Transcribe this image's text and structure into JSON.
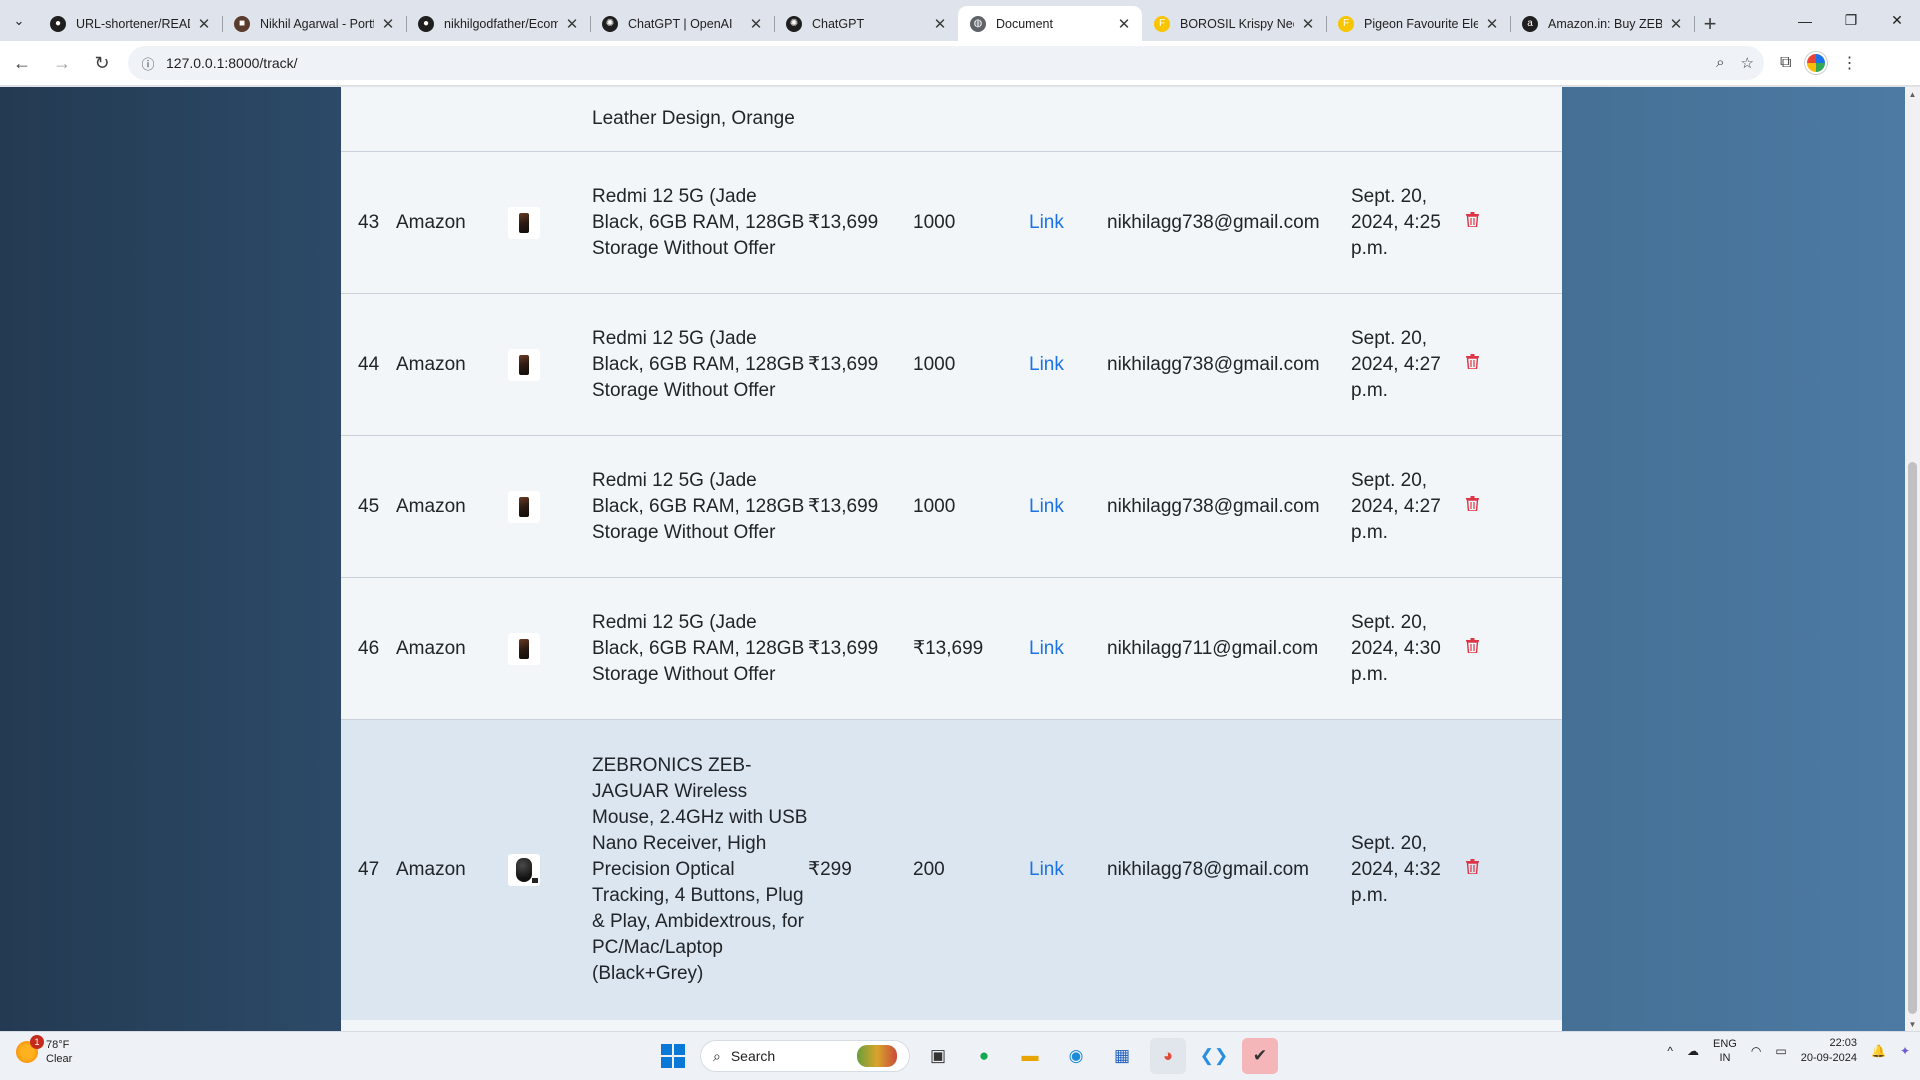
{
  "browser": {
    "tabs": [
      {
        "title": "URL-shortener/READM",
        "icon": "github-icon",
        "color": "#1f1f1f",
        "active": false
      },
      {
        "title": "Nikhil Agarwal - Portf",
        "icon": "portfolio-icon",
        "color": "#5a3b2e",
        "active": false
      },
      {
        "title": "nikhilgodfather/Ecom",
        "icon": "github-icon",
        "color": "#1f1f1f",
        "active": false
      },
      {
        "title": "ChatGPT | OpenAI",
        "icon": "openai-icon",
        "color": "#1f1f1f",
        "active": false
      },
      {
        "title": "ChatGPT",
        "icon": "openai-icon",
        "color": "#1f1f1f",
        "active": false
      },
      {
        "title": "Document",
        "icon": "globe-icon",
        "color": "#5f6368",
        "active": true
      },
      {
        "title": "BOROSIL Krispy Neo",
        "icon": "flipkart-icon",
        "color": "#f7c600",
        "active": false
      },
      {
        "title": "Pigeon Favourite Elec",
        "icon": "flipkart-icon",
        "color": "#f7c600",
        "active": false
      },
      {
        "title": "Amazon.in: Buy ZEBR",
        "icon": "amazon-icon",
        "color": "#1f1f1f",
        "active": false
      }
    ],
    "url": "127.0.0.1:8000/track/"
  },
  "partial_row": {
    "name_lines": "Leather Design, Orange"
  },
  "rows": [
    {
      "id": "43",
      "store": "Amazon",
      "image": "phone-thumbnail",
      "name": "Redmi 12 5G (Jade Black, 6GB RAM, 128GB Storage Without Offer",
      "price": "₹13,699",
      "target": "1000",
      "link": "Link",
      "email": "nikhilagg738@gmail.com",
      "date": "Sept. 20, 2024, 4:25 p.m."
    },
    {
      "id": "44",
      "store": "Amazon",
      "image": "phone-thumbnail",
      "name": "Redmi 12 5G (Jade Black, 6GB RAM, 128GB Storage Without Offer",
      "price": "₹13,699",
      "target": "1000",
      "link": "Link",
      "email": "nikhilagg738@gmail.com",
      "date": "Sept. 20, 2024, 4:27 p.m."
    },
    {
      "id": "45",
      "store": "Amazon",
      "image": "phone-thumbnail",
      "name": "Redmi 12 5G (Jade Black, 6GB RAM, 128GB Storage Without Offer",
      "price": "₹13,699",
      "target": "1000",
      "link": "Link",
      "email": "nikhilagg738@gmail.com",
      "date": "Sept. 20, 2024, 4:27 p.m."
    },
    {
      "id": "46",
      "store": "Amazon",
      "image": "phone-thumbnail",
      "name": "Redmi 12 5G (Jade Black, 6GB RAM, 128GB Storage Without Offer",
      "price": "₹13,699",
      "target": "₹13,699",
      "link": "Link",
      "email": "nikhilagg711@gmail.com",
      "date": "Sept. 20, 2024, 4:30 p.m."
    },
    {
      "id": "47",
      "store": "Amazon",
      "image": "mouse-thumbnail",
      "name": "ZEBRONICS ZEB-JAGUAR Wireless Mouse, 2.4GHz with USB Nano Receiver, High Precision Optical Tracking, 4 Buttons, Plug & Play, Ambidextrous, for PC/Mac/Laptop (Black+Grey)",
      "price": "₹299",
      "target": "200",
      "link": "Link",
      "email": "nikhilagg78@gmail.com",
      "date": "Sept. 20, 2024, 4:32 p.m."
    }
  ],
  "taskbar": {
    "weather_temp": "78°F",
    "weather_desc": "Clear",
    "weather_badge": "1",
    "search_label": "Search",
    "lang_top": "ENG",
    "lang_bottom": "IN",
    "time": "22:03",
    "date": "20-09-2024"
  },
  "colors": {
    "link": "#1a73e8",
    "delete": "#dc3545",
    "hover_row": "#dbe6f1"
  }
}
